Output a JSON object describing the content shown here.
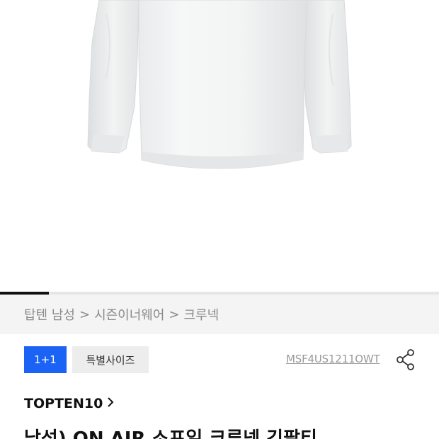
{
  "product": {
    "image_alt": "white long sleeve crew neck t-shirt",
    "gallery": {
      "current": 1,
      "total": 9
    }
  },
  "breadcrumb": {
    "items": [
      "탑텐 남성",
      "시즌이너웨어",
      "크루넥"
    ],
    "separator": ">"
  },
  "badges": {
    "promo": "1+1",
    "size": "특별사이즈"
  },
  "product_code": "MSF4US1211OWT",
  "brand": {
    "name": "TOPTEN10"
  },
  "title": "남성) ON AIR 소프일 크루넥 긴팔티",
  "colors": {
    "promo_badge": "#1a63f5",
    "breadcrumb_bg": "#f4f4f4",
    "indicator": "#111111"
  }
}
